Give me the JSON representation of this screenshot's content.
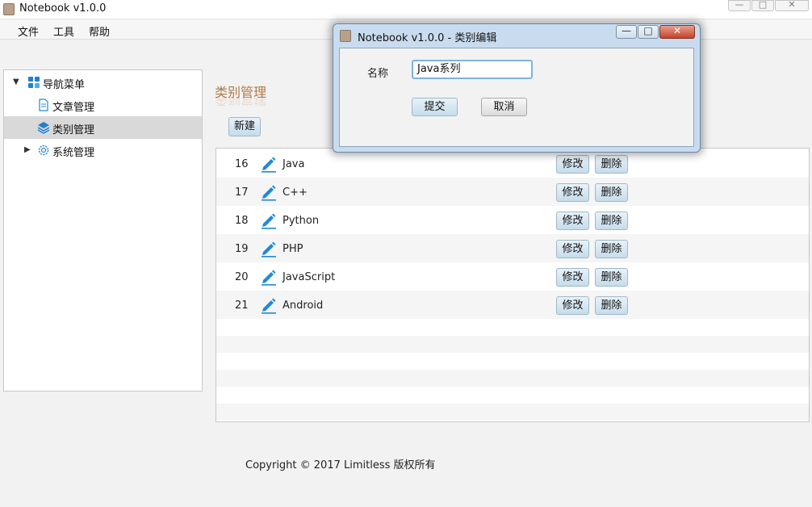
{
  "window": {
    "title": "Notebook v1.0.0",
    "controls": {
      "minimize": "—",
      "maximize": "□",
      "close": "✕"
    }
  },
  "menubar": {
    "items": [
      "文件",
      "工具",
      "帮助"
    ]
  },
  "sidebar": {
    "root": {
      "label": "导航菜单",
      "expanded": true,
      "icon": "grid-icon"
    },
    "items": [
      {
        "label": "文章管理",
        "icon": "document-icon"
      },
      {
        "label": "类别管理",
        "icon": "layers-icon",
        "selected": true
      },
      {
        "label": "系统管理",
        "icon": "gear-icon",
        "collapsed": true
      }
    ]
  },
  "main": {
    "heading": "类别管理",
    "new_button": "新建",
    "rows": [
      {
        "id": "16",
        "name": "Java"
      },
      {
        "id": "17",
        "name": "C++"
      },
      {
        "id": "18",
        "name": "Python"
      },
      {
        "id": "19",
        "name": "PHP"
      },
      {
        "id": "20",
        "name": "JavaScript"
      },
      {
        "id": "21",
        "name": "Android"
      }
    ],
    "edit_label": "修改",
    "delete_label": "删除"
  },
  "footer": {
    "text": "Copyright © 2017 Limitless 版权所有"
  },
  "dialog": {
    "title": "Notebook v1.0.0 - 类别编辑",
    "name_label": "名称",
    "name_value": "Java系列",
    "submit_label": "提交",
    "cancel_label": "取消"
  },
  "colors": {
    "heading": "#b0794a",
    "pen_icon": "#1f8ad6",
    "dialog_frame": "#c9dcef",
    "close_button": "#c4432b"
  }
}
